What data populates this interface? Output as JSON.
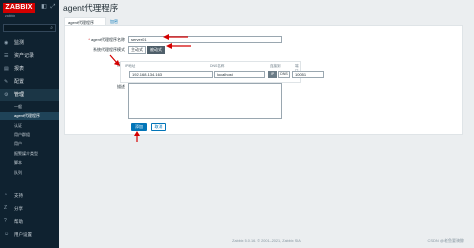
{
  "sidebar": {
    "logo": "ZABBIX",
    "host": "zabbix",
    "nav": [
      {
        "icon": "◉",
        "label": "监测"
      },
      {
        "icon": "☰",
        "label": "资产记录"
      },
      {
        "icon": "▤",
        "label": "报表"
      },
      {
        "icon": "✎",
        "label": "配置"
      },
      {
        "icon": "⚙",
        "label": "管理"
      }
    ],
    "sub_items": [
      "一般",
      "agent代理程序",
      "认证",
      "用户群组",
      "用户",
      "报警媒介类型",
      "脚本",
      "队列"
    ],
    "bottom": [
      {
        "icon": "◔",
        "label": "支持"
      },
      {
        "icon": "Z",
        "label": "分享"
      },
      {
        "icon": "?",
        "label": "帮助"
      },
      {
        "icon": "☺",
        "label": "用户设置"
      }
    ]
  },
  "header": {
    "title": "agent代理程序"
  },
  "tabs": [
    "agent代理程序",
    "加密"
  ],
  "form": {
    "name_label": "agent代理程序名称",
    "name_value": "server01",
    "mode_label": "系统代理程序模式",
    "mode_options": [
      "主动式",
      "被动式"
    ],
    "interface_label": "接口",
    "col_ip": "IP地址",
    "col_dns": "DNS名称",
    "col_connect": "连接到",
    "col_port": "端口",
    "ip_value": "192.168.134.163",
    "dns_value": "localhost",
    "conn_ip": "IP",
    "conn_dns": "DNS",
    "port_value": "10051",
    "desc_label": "描述"
  },
  "buttons": {
    "add": "添加",
    "cancel": "取消"
  },
  "footer": {
    "text": "Zabbix 5.0.16. © 2001–2021, Zabbix SIA",
    "watermark": "CSDN @老鱼要骑鲸"
  },
  "colors": {
    "sidebar_bg": "#0f2230",
    "accent": "#0275b8",
    "logo": "#d40000",
    "arrow": "#d40000"
  }
}
